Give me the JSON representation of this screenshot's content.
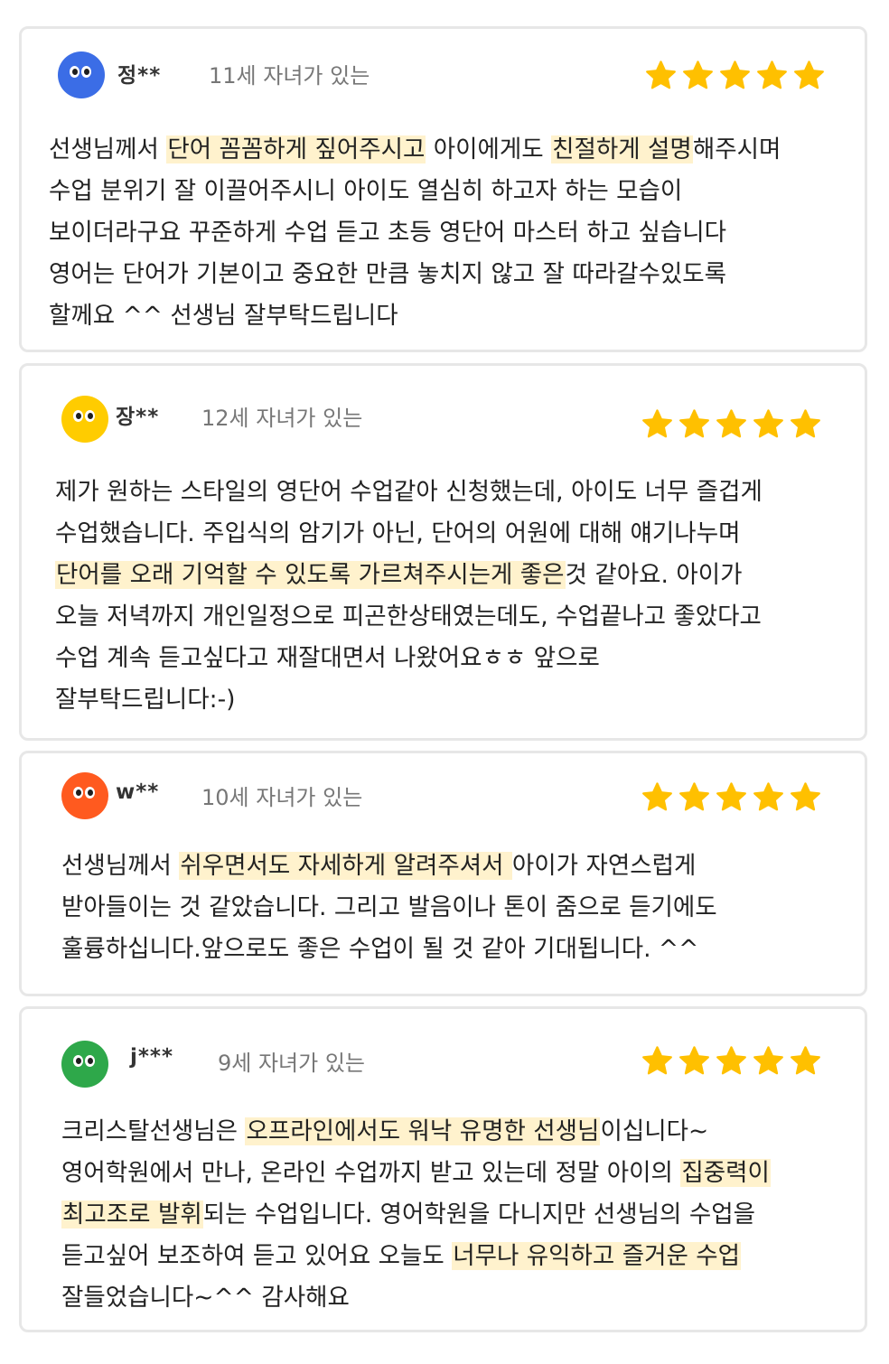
{
  "colors": {
    "star": "#ffc000",
    "highlight": "#fff2cd",
    "card_border": "#e7e7e7"
  },
  "reviews": [
    {
      "name": "정**",
      "age": "11세 자녀가 있는",
      "avatar_color": "#3b6de6",
      "rating": 5,
      "lines": [
        [
          "선생님께서 ",
          {
            "hl": "단어 꼼꼼하게 짚어주시고"
          },
          " 아이에게도 ",
          {
            "hl": "친절하게 설명"
          },
          "해주시며"
        ],
        [
          "수업 분위기 잘 이끌어주시니 아이도 열심히 하고자 하는 모습이"
        ],
        [
          "보이더라구요 꾸준하게 수업 듣고 초등 영단어 마스터 하고 싶습니다"
        ],
        [
          "영어는 단어가 기본이고 중요한 만큼 놓치지 않고 잘 따라갈수있도록"
        ],
        [
          "할께요 ^^ 선생님 잘부탁드립니다"
        ]
      ]
    },
    {
      "name": "장**",
      "age": "12세 자녀가 있는",
      "avatar_color": "#ffcc00",
      "rating": 5,
      "lines": [
        [
          "제가 원하는 스타일의 영단어 수업같아 신청했는데, 아이도 너무 즐겁게"
        ],
        [
          "수업했습니다. 주입식의 암기가 아닌, 단어의 어원에 대해 얘기나누며"
        ],
        [
          {
            "hl": "단어를 오래 기억할 수 있도록 가르쳐주시는게 좋은"
          },
          "것 같아요. 아이가"
        ],
        [
          "오늘 저녁까지 개인일정으로 피곤한상태였는데도, 수업끝나고 좋았다고"
        ],
        [
          "수업 계속 듣고싶다고 재잘대면서 나왔어요ㅎㅎ 앞으로"
        ],
        [
          "잘부탁드립니다:-)"
        ]
      ]
    },
    {
      "name": "w**",
      "age": "10세 자녀가 있는",
      "avatar_color": "#ff5a1f",
      "rating": 5,
      "lines": [
        [
          "선생님께서 ",
          {
            "hl": "쉬우면서도 자세하게 알려주셔서 "
          },
          "아이가 자연스럽게"
        ],
        [
          "받아들이는 것 같았습니다. 그리고 발음이나 톤이 줌으로 듣기에도"
        ],
        [
          "훌륭하십니다.앞으로도 좋은 수업이 될 것 같아 기대됩니다. ^^"
        ]
      ]
    },
    {
      "name": "j***",
      "age": "9세 자녀가 있는",
      "avatar_color": "#2ea84a",
      "rating": 5,
      "lines": [
        [
          "크리스탈선생님은 ",
          {
            "hl": "오프라인에서도 워낙 유명한 선생님"
          },
          "이십니다~"
        ],
        [
          "영어학원에서 만나, 온라인 수업까지 받고 있는데 정말 아이의 ",
          {
            "hl": "집중력이"
          }
        ],
        [
          {
            "hl": "최고조로 발휘"
          },
          "되는 수업입니다. 영어학원을 다니지만 선생님의 수업을"
        ],
        [
          "듣고싶어 보조하여 듣고 있어요 오늘도 ",
          {
            "hl": "너무나 유익하고 즐거운 수업"
          }
        ],
        [
          "잘들었습니다~^^ 감사해요"
        ]
      ]
    }
  ]
}
